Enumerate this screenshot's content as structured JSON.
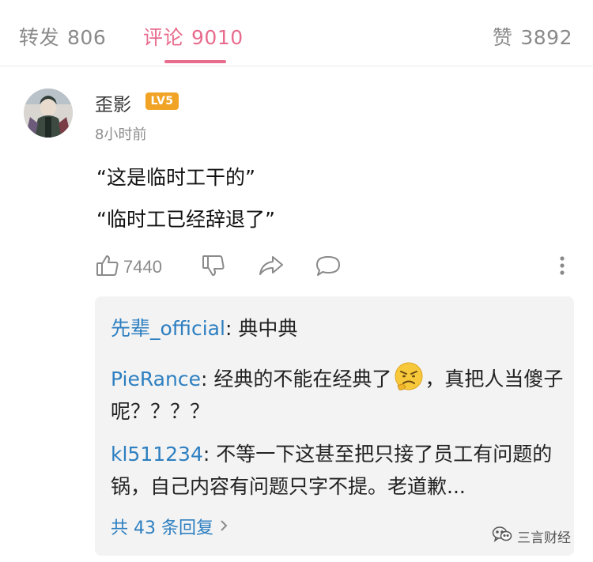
{
  "tabs": {
    "repost": {
      "label": "转发",
      "count": "806"
    },
    "comments": {
      "label": "评论",
      "count": "9010"
    },
    "likes": {
      "label": "赞",
      "count": "3892"
    }
  },
  "comment": {
    "username": "歪影",
    "level": "LV5",
    "time": "8小时前",
    "lines": [
      "“这是临时工干的”",
      "“临时工已经辞退了”"
    ],
    "like_count": "7440"
  },
  "replies": [
    {
      "author": "先辈_official",
      "separator": ": ",
      "text": "典中典"
    },
    {
      "author": "PieRance",
      "separator": ": ",
      "text_before": "经典的不能在经典了",
      "emoji": "frowning-thinking-emoji",
      "text_after": "，真把人当傻子呢？？？？"
    },
    {
      "author": "kl511234",
      "separator": ": ",
      "text": "不等一下这甚至把只接了员工有问题的锅，自己内容有问题只字不提。老道歉..."
    }
  ],
  "view_replies": "共 43 条回复",
  "watermark": "三言财经",
  "colors": {
    "accent": "#e86c8d",
    "link": "#2d7fc1",
    "badge": "#f1a326",
    "reply_bg": "#f3f3f3"
  }
}
